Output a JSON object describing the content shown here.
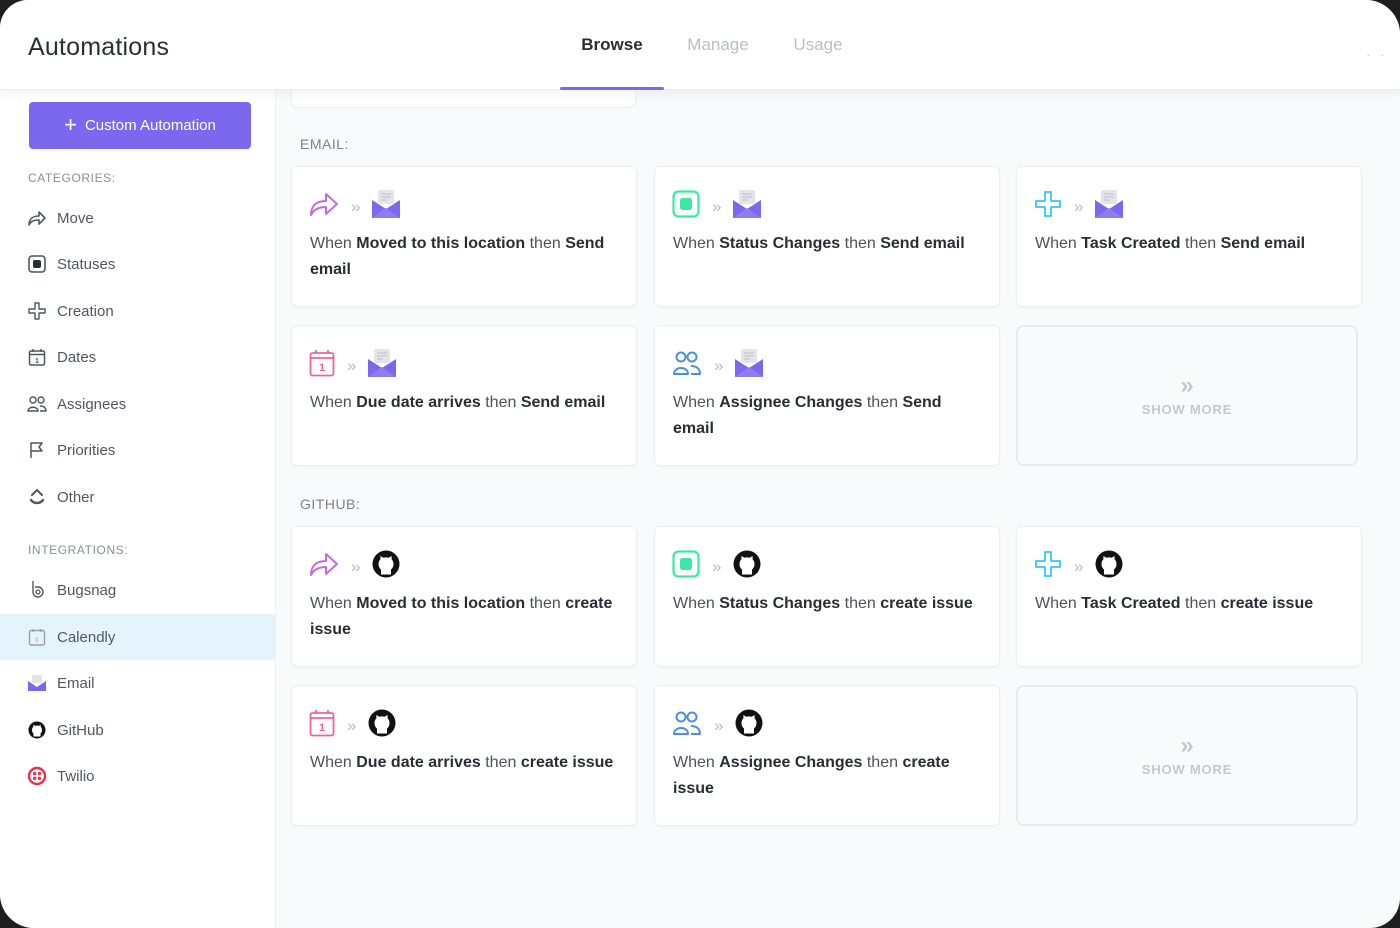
{
  "header": {
    "title": "Automations",
    "tabs": [
      {
        "label": "Browse",
        "active": true
      },
      {
        "label": "Manage",
        "active": false
      },
      {
        "label": "Usage",
        "active": false
      }
    ],
    "overflow": "· ·"
  },
  "sidebar": {
    "custom_button": {
      "icon": "+",
      "label": "Custom Automation"
    },
    "categories_label": "CATEGORIES:",
    "categories": [
      {
        "label": "Move",
        "icon": "move-arrow-icon"
      },
      {
        "label": "Statuses",
        "icon": "status-square-icon"
      },
      {
        "label": "Creation",
        "icon": "plus-outline-icon"
      },
      {
        "label": "Dates",
        "icon": "calendar-icon"
      },
      {
        "label": "Assignees",
        "icon": "users-icon"
      },
      {
        "label": "Priorities",
        "icon": "flag-icon"
      },
      {
        "label": "Other",
        "icon": "other-chevrons-icon"
      }
    ],
    "integrations_label": "INTEGRATIONS:",
    "integrations": [
      {
        "label": "Bugsnag",
        "icon": "bugsnag-icon",
        "selected": false
      },
      {
        "label": "Calendly",
        "icon": "calendly-icon",
        "selected": true
      },
      {
        "label": "Email",
        "icon": "email-icon",
        "selected": false
      },
      {
        "label": "GitHub",
        "icon": "github-icon",
        "selected": false
      },
      {
        "label": "Twilio",
        "icon": "twilio-icon",
        "selected": false
      }
    ]
  },
  "groups": [
    {
      "label": "EMAIL:",
      "cards": [
        {
          "trigger_icon": "move-arrow-icon",
          "action_icon": "email-icon",
          "when": "When",
          "trigger": "Moved to this location",
          "then": "then",
          "action": "Send email"
        },
        {
          "trigger_icon": "status-square-icon",
          "action_icon": "email-icon",
          "when": "When",
          "trigger": "Status Changes",
          "then": "then",
          "action": "Send email"
        },
        {
          "trigger_icon": "plus-outline-icon",
          "action_icon": "email-icon",
          "when": "When",
          "trigger": "Task Created",
          "then": "then",
          "action": "Send email"
        },
        {
          "trigger_icon": "calendar-icon",
          "action_icon": "email-icon",
          "when": "When",
          "trigger": "Due date arrives",
          "then": "then",
          "action": "Send email"
        },
        {
          "trigger_icon": "users-icon",
          "action_icon": "email-icon",
          "when": "When",
          "trigger": "Assignee Changes",
          "then": "then",
          "action": "Send email"
        }
      ],
      "show_more": {
        "icon": "»",
        "label": "SHOW MORE"
      }
    },
    {
      "label": "GITHUB:",
      "cards": [
        {
          "trigger_icon": "move-arrow-icon",
          "action_icon": "github-icon",
          "when": "When",
          "trigger": "Moved to this location",
          "then": "then",
          "action": "create issue"
        },
        {
          "trigger_icon": "status-square-icon",
          "action_icon": "github-icon",
          "when": "When",
          "trigger": "Status Changes",
          "then": "then",
          "action": "create issue"
        },
        {
          "trigger_icon": "plus-outline-icon",
          "action_icon": "github-icon",
          "when": "When",
          "trigger": "Task Created",
          "then": "then",
          "action": "create issue"
        },
        {
          "trigger_icon": "calendar-icon",
          "action_icon": "github-icon",
          "when": "When",
          "trigger": "Due date arrives",
          "then": "then",
          "action": "create issue"
        },
        {
          "trigger_icon": "users-icon",
          "action_icon": "github-icon",
          "when": "When",
          "trigger": "Assignee Changes",
          "then": "then",
          "action": "create issue"
        }
      ],
      "show_more": {
        "icon": "»",
        "label": "SHOW MORE"
      }
    }
  ],
  "chevron_glyph": "»",
  "colors": {
    "accent": "#7b68ee",
    "move": "#c56be0",
    "status": "#3ee8a4",
    "creation": "#49ccf9",
    "dates": "#f062a4",
    "assignees": "#4a90e2",
    "email": "#7b68ee",
    "github": "#111111",
    "twilio": "#f22f46",
    "selected_bg": "#e5f4fc"
  }
}
